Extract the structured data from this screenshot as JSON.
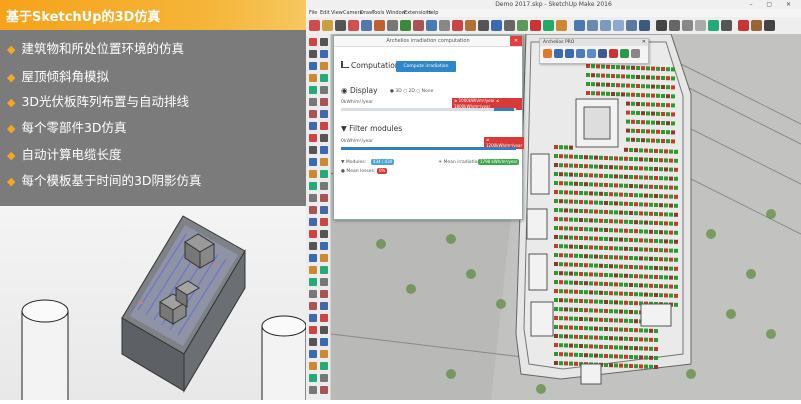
{
  "slide": {
    "title": "基于SketchUp的3D仿真",
    "bullets": [
      "建筑物和所处位置环境的仿真",
      "屋顶倾斜角模拟",
      "3D光伏板阵列布置与自动排线",
      "每个零部件3D仿真",
      "自动计算电缆长度",
      "每个模板基于时间的3D阴影仿真"
    ],
    "accent_color": "#f5a623",
    "panel_color": "#7b7b7b"
  },
  "app": {
    "window_title": "Demo 2017.skp - SketchUp Make 2016",
    "window_controls": "– ▢ ✕",
    "menu": [
      "File",
      "Edit",
      "View",
      "Camera",
      "Draw",
      "Tools",
      "Window",
      "Extensions",
      "Help"
    ]
  },
  "irradiation_dialog": {
    "title": "Archelios irradiation computation",
    "close_icon": "✕",
    "computation_label": "Computation",
    "compute_button": "Compute irradiation",
    "display_label": "Display",
    "display_options": [
      "3D",
      "2D",
      "None"
    ],
    "display_selected": "3D",
    "display_scale_left": "0kWh/m²/year",
    "display_scale_right": "1800kWh/m²/year",
    "display_red_tag": "≥ 1000kWh/m²/year ≤ 1800kWh/m²/year",
    "filter_label": "Filter modules",
    "filter_scale_left": "0kWh/m²/year",
    "filter_red_tag": "≥ 1200kWh/m²/year",
    "modules_label": "Modules:",
    "modules_value": "434 / 434",
    "mean_losses_label": "Mean losses:",
    "mean_losses_value": "0%",
    "mean_irradiation_label": "Mean irradiation:",
    "mean_irradiation_value": "1798 kWh/m²/year"
  },
  "pro_dialog": {
    "title": "Archelios PRO",
    "close_icon": "✕"
  }
}
